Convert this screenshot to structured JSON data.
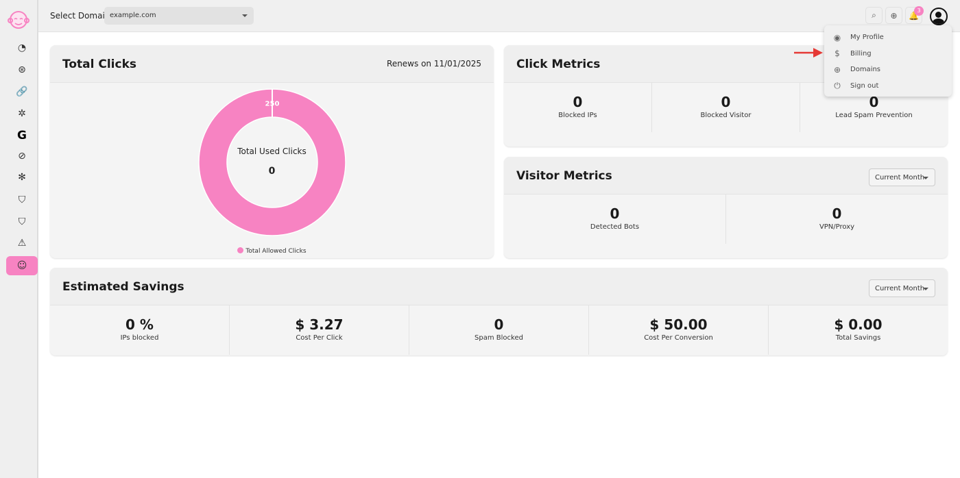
{
  "sidebar": {
    "items": [
      {
        "icon": "pie-chart-icon",
        "glyph": "◔"
      },
      {
        "icon": "dashboard-icon",
        "glyph": "⊛"
      },
      {
        "icon": "link-icon",
        "glyph": "🔗"
      },
      {
        "icon": "click-icon",
        "glyph": "✲"
      },
      {
        "icon": "google-icon",
        "glyph": "G"
      },
      {
        "icon": "block-icon",
        "glyph": "⊘"
      },
      {
        "icon": "bug-icon",
        "glyph": "✻"
      },
      {
        "icon": "shield-check-icon",
        "glyph": "⛉"
      },
      {
        "icon": "shield-alert-icon",
        "glyph": "⛉"
      },
      {
        "icon": "warning-icon",
        "glyph": "⚠"
      },
      {
        "icon": "monkey-icon",
        "glyph": "☺",
        "active": true
      }
    ]
  },
  "topbar": {
    "domain_label": "Select Domain",
    "domain_value": "example.com",
    "notification_count": "3"
  },
  "profile_menu": {
    "items": [
      {
        "label": "My Profile",
        "icon": "user-circle-icon",
        "glyph": "◉"
      },
      {
        "label": "Billing",
        "icon": "dollar-icon",
        "glyph": "$"
      },
      {
        "label": "Domains",
        "icon": "globe-icon",
        "glyph": "⊕"
      },
      {
        "label": "Sign out",
        "icon": "power-icon",
        "glyph": "⏻"
      }
    ]
  },
  "annotation": {
    "color": "#e53935"
  },
  "total_clicks": {
    "title": "Total Clicks",
    "renews": "Renews on 11/01/2025",
    "center_label": "Total Used Clicks",
    "center_value": "0",
    "legend": "Total Allowed Clicks"
  },
  "chart_data": {
    "type": "pie",
    "variant": "doughnut",
    "labels": [
      "Total Allowed Clicks"
    ],
    "values": [
      250
    ],
    "data_labels": [
      "250"
    ],
    "colors": [
      "#f783c2"
    ],
    "legend": "bottom"
  },
  "click_metrics": {
    "title": "Click Metrics",
    "items": [
      {
        "value": "0",
        "label": "Blocked IPs"
      },
      {
        "value": "0",
        "label": "Blocked Visitor"
      },
      {
        "value": "0",
        "label": "Lead Spam Prevention"
      }
    ]
  },
  "visitor_metrics": {
    "title": "Visitor Metrics",
    "period": "Current Month",
    "items": [
      {
        "value": "0",
        "label": "Detected Bots"
      },
      {
        "value": "0",
        "label": "VPN/Proxy"
      }
    ]
  },
  "savings": {
    "title": "Estimated Savings",
    "period": "Current Month",
    "items": [
      {
        "value": "0 %",
        "label": "IPs blocked"
      },
      {
        "value": "$ 3.27",
        "label": "Cost Per Click"
      },
      {
        "value": "0",
        "label": "Spam Blocked"
      },
      {
        "value": "$ 50.00",
        "label": "Cost Per Conversion"
      },
      {
        "value": "$ 0.00",
        "label": "Total Savings"
      }
    ]
  },
  "colors": {
    "accent": "#f783c2"
  }
}
